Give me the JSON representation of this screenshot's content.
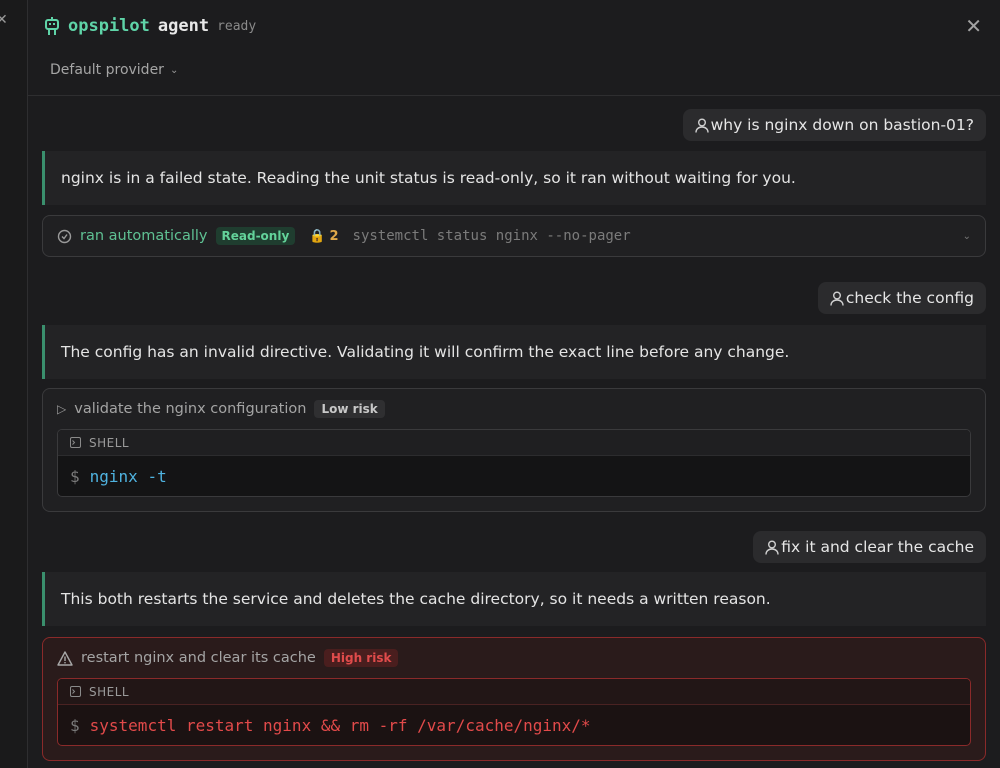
{
  "header": {
    "brand": "opspilot",
    "agent": "agent",
    "status": "ready",
    "provider": "Default provider"
  },
  "messages": {
    "user1": "why is nginx down on bastion-01?",
    "assistant1": "nginx is in a failed state. Reading the unit status is read-only, so it ran without waiting for you.",
    "auto_tool": {
      "label": "ran automatically",
      "badge": "Read-only",
      "count": "2",
      "command": "systemctl status nginx --no-pager"
    },
    "user2": "check the config",
    "assistant2": "The config has an invalid directive. Validating it will confirm the exact line before any change.",
    "action1": {
      "title": "validate the nginx configuration",
      "badge": "Low risk",
      "shell_label": "SHELL",
      "prompt": "$",
      "command": "nginx -t"
    },
    "user3": "fix it and clear the cache",
    "assistant3": "This both restarts the service and deletes the cache directory, so it needs a written reason.",
    "action2": {
      "title": "restart nginx and clear its cache",
      "badge": "High risk",
      "shell_label": "SHELL",
      "prompt": "$",
      "command": "systemctl restart nginx && rm -rf /var/cache/nginx/*"
    }
  },
  "colors": {
    "accent": "#5fd4a8",
    "assistant_border": "#3a8f6d",
    "high_risk": "#e04b4b",
    "low_cmd": "#4fb3e0"
  }
}
